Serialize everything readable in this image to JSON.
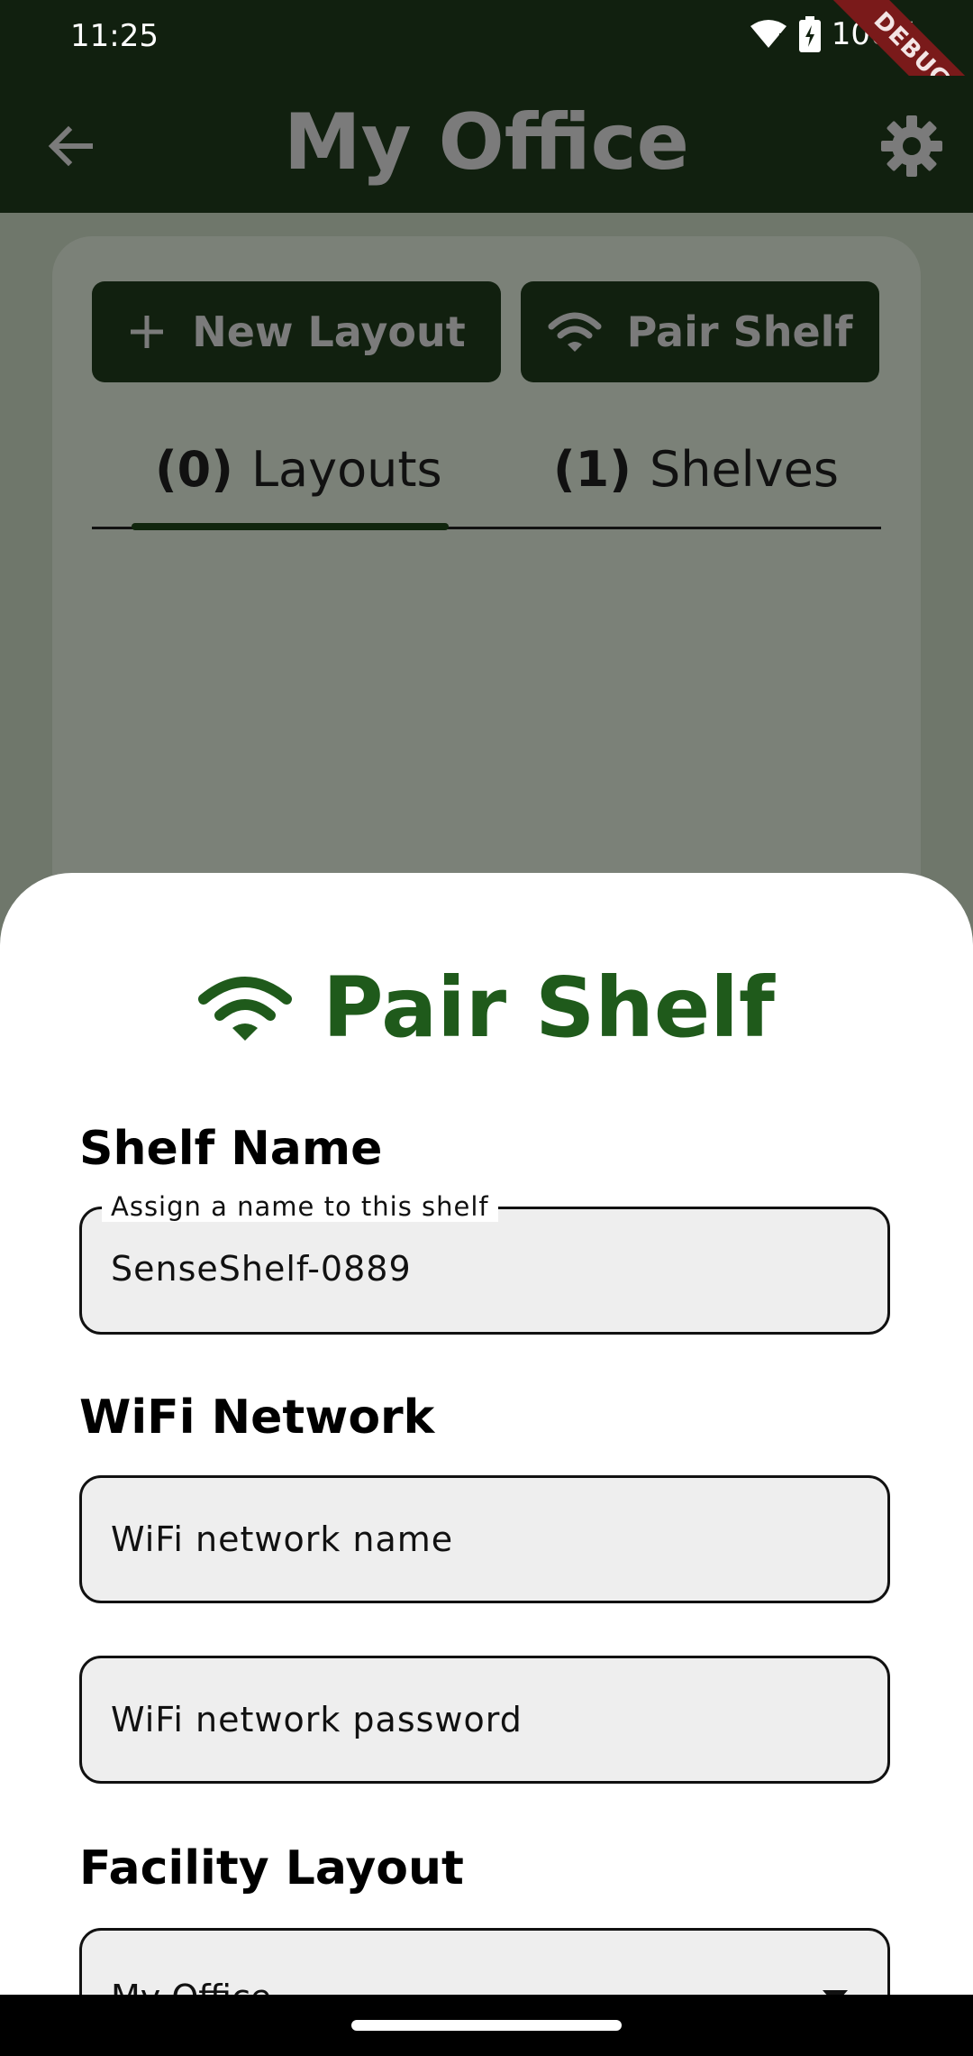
{
  "status_bar": {
    "time": "11:25",
    "battery": "100%",
    "debug": "DEBUG"
  },
  "app_bar": {
    "title": "My Office"
  },
  "actions": {
    "new_layout": "New Layout",
    "pair_shelf": "Pair Shelf"
  },
  "tabs": [
    {
      "count": "(0)",
      "label": "Layouts"
    },
    {
      "count": "(1)",
      "label": "Shelves"
    }
  ],
  "sheet": {
    "title": "Pair Shelf",
    "shelf_name_label": "Shelf Name",
    "shelf_name_field_label": "Assign a name to this shelf",
    "shelf_name_value": "SenseShelf-0889",
    "wifi_label": "WiFi Network",
    "wifi_name_placeholder": "WiFi network name",
    "wifi_password_placeholder": "WiFi network password",
    "facility_label": "Facility Layout",
    "facility_value": "My Office"
  },
  "colors": {
    "brand_dark": "#11200f",
    "brand_green": "#1f5a1b"
  }
}
